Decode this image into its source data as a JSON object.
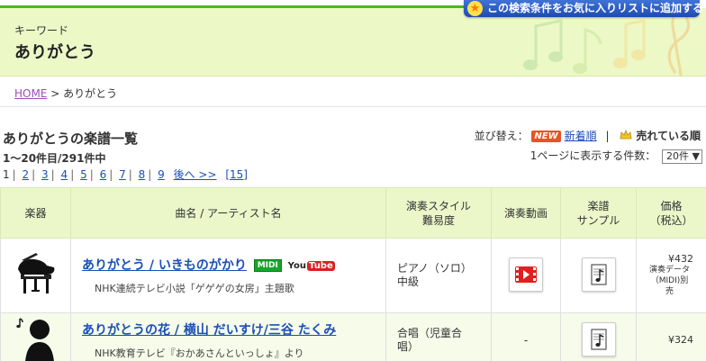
{
  "header": {
    "keyword_label": "キーワード",
    "keyword": "ありがとう",
    "favorite_button": "この検索条件をお気に入りリストに追加する"
  },
  "breadcrumb": {
    "home": "HOME",
    "separator": ">",
    "current": "ありがとう"
  },
  "listing": {
    "title": "ありがとうの楽譜一覧",
    "range": "1〜20件目/291件中",
    "pages": [
      "1",
      "2",
      "3",
      "4",
      "5",
      "6",
      "7",
      "8",
      "9"
    ],
    "next": "後へ >>",
    "last": "[15]"
  },
  "sort": {
    "label": "並び替え：",
    "new_badge": "NEW",
    "newest": "新着順",
    "divider": "|",
    "best_selling": "売れている順",
    "perpage_label": "1ページに表示する件数：",
    "perpage_value": "20件",
    "perpage_arrow": "▼"
  },
  "table": {
    "headers": {
      "instrument": "楽器",
      "title": "曲名 / アーティスト名",
      "style_line1": "演奏スタイル",
      "style_line2": "難易度",
      "video": "演奏動画",
      "sample_line1": "楽譜",
      "sample_line2": "サンプル",
      "price_line1": "価格",
      "price_line2": "（税込）"
    },
    "rows": [
      {
        "title": "ありがとう / いきものがかり",
        "midi_badge": "MIDI",
        "yt_prefix": "You",
        "yt_box": "Tube",
        "subtitle": "NHK連続テレビ小説「ゲゲゲの女房」主題歌",
        "style": "ピアノ（ソロ）",
        "level": "中級",
        "price": "¥432",
        "price_note_1": "演奏データ",
        "price_note_2": "（MIDI)別",
        "price_note_3": "売"
      },
      {
        "title": "ありがとうの花 / 横山 だいすけ/三谷 たくみ",
        "subtitle": "NHK教育テレビ『おかあさんといっしょ』より",
        "style": "合唱（児童合",
        "level": "唱）",
        "video": "-",
        "price": "¥324"
      }
    ]
  },
  "colors": {
    "header_bg": "#ecf8c6",
    "accent_green": "#4bb81f",
    "link_blue": "#1a4fb5",
    "badge_orange": "#e6551e",
    "fav_button_blue": "#2a5cc4"
  }
}
